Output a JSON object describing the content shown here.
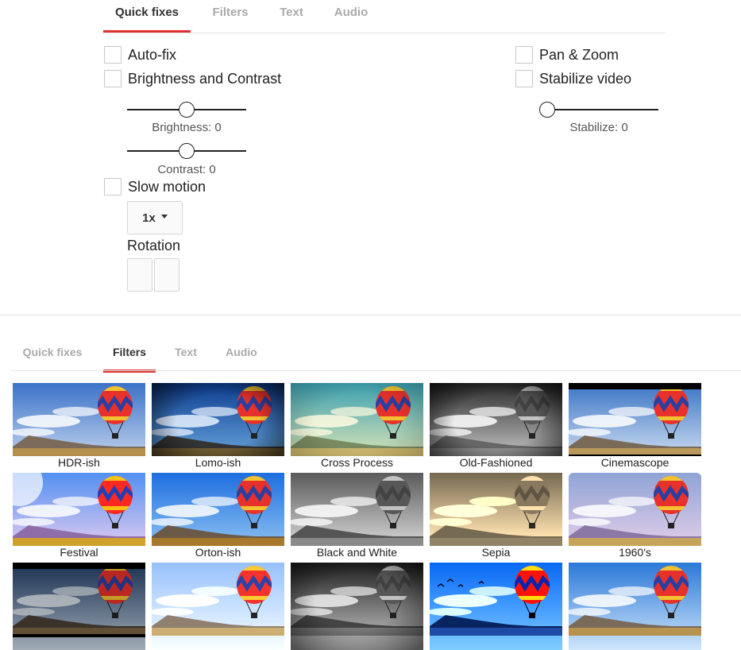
{
  "top_tabs": {
    "items": [
      {
        "label": "Quick fixes",
        "active": true
      },
      {
        "label": "Filters",
        "active": false
      },
      {
        "label": "Text",
        "active": false
      },
      {
        "label": "Audio",
        "active": false
      }
    ]
  },
  "quick_fixes": {
    "auto_fix": {
      "label": "Auto-fix",
      "checked": false
    },
    "brightness_contrast": {
      "label": "Brightness and Contrast",
      "checked": false
    },
    "brightness": {
      "caption": "Brightness: 0",
      "value": 0,
      "min": -100,
      "max": 100
    },
    "contrast": {
      "caption": "Contrast: 0",
      "value": 0,
      "min": -100,
      "max": 100
    },
    "slow_motion": {
      "label": "Slow motion",
      "checked": false
    },
    "speed": {
      "value": "1x"
    },
    "rotation": {
      "label": "Rotation"
    },
    "pan_zoom": {
      "label": "Pan & Zoom",
      "checked": false
    },
    "stabilize_video": {
      "label": "Stabilize video",
      "checked": false
    },
    "stabilize": {
      "caption": "Stabilize: 0",
      "value": 0,
      "min": 0,
      "max": 100
    }
  },
  "bottom_tabs": {
    "items": [
      {
        "label": "Quick fixes",
        "active": false
      },
      {
        "label": "Filters",
        "active": true
      },
      {
        "label": "Text",
        "active": false
      },
      {
        "label": "Audio",
        "active": false
      }
    ]
  },
  "filters": {
    "items": [
      {
        "label": "HDR-ish",
        "style": "hdr"
      },
      {
        "label": "Lomo-ish",
        "style": "lomo"
      },
      {
        "label": "Cross Process",
        "style": "cross"
      },
      {
        "label": "Old-Fashioned",
        "style": "oldbw"
      },
      {
        "label": "Cinemascope",
        "style": "cinema"
      },
      {
        "label": "Festival",
        "style": "festival"
      },
      {
        "label": "Orton-ish",
        "style": "orton"
      },
      {
        "label": "Black and White",
        "style": "bw"
      },
      {
        "label": "Sepia",
        "style": "sepia"
      },
      {
        "label": "1960's",
        "style": "sixties"
      },
      {
        "label": "",
        "style": "cinemadark"
      },
      {
        "label": "",
        "style": "soft"
      },
      {
        "label": "",
        "style": "bwdark"
      },
      {
        "label": "",
        "style": "posterize"
      },
      {
        "label": "",
        "style": "normal"
      }
    ]
  },
  "colors": {
    "tab_active_underline": "#dd3333",
    "tab_inactive_text": "#aaaaaa",
    "tab_active_text": "#333333",
    "balloon_red": "#e8312a",
    "balloon_stripe": "#2b3fa0",
    "balloon_yellow": "#f2c230"
  },
  "icons": {
    "dropdown_caret": "caret-down-icon",
    "rotate_left": "rotate-left-icon",
    "rotate_right": "rotate-right-icon"
  }
}
